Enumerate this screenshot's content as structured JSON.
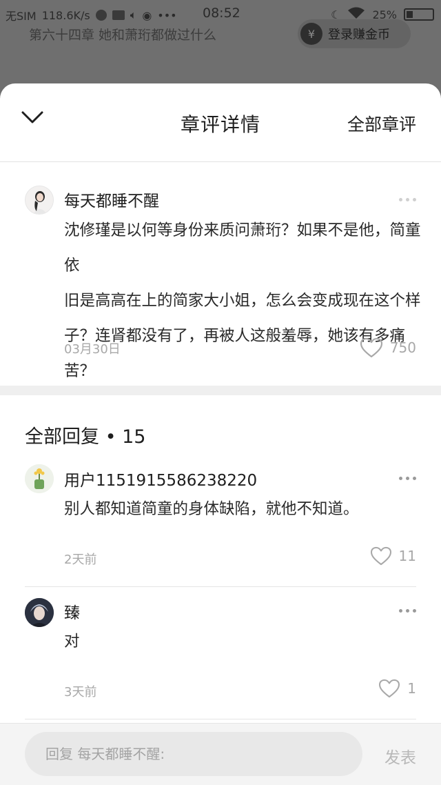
{
  "status_bar": {
    "carrier": "无SIM",
    "network_speed": "118.6K/s",
    "time": "08:52",
    "battery": "25%"
  },
  "background_page": {
    "chapter_title": "第六十四章 她和萧珩都做过什么",
    "login_button": "登录赚金币",
    "coin_symbol": "¥"
  },
  "sheet": {
    "title": "章评详情",
    "all_comments_link": "全部章评"
  },
  "main_comment": {
    "username": "每天都睡不醒",
    "lines": [
      "沈修瑾是以何等身份来质问萧珩？如果不是他，简童依",
      "旧是高高在上的简家大小姐，怎么会变成现在这个样",
      "子？连肾都没有了，再被人这般羞辱，她该有多痛苦？"
    ],
    "date": "03月30日",
    "likes": "750"
  },
  "replies": {
    "title": "全部回复 • 15",
    "items": [
      {
        "username": "用户1151915586238220",
        "text": "别人都知道简童的身体缺陷，就他不知道。",
        "time": "2天前",
        "likes": "11"
      },
      {
        "username": "臻",
        "text": "对",
        "time": "3天前",
        "likes": "1"
      }
    ]
  },
  "input": {
    "placeholder": "回复 每天都睡不醒:",
    "send_label": "发表"
  },
  "colors": {
    "overlay": "#6f6f6f",
    "sheet_bg": "#ffffff",
    "muted_text": "#a8a8a8",
    "band": "#efefef"
  }
}
